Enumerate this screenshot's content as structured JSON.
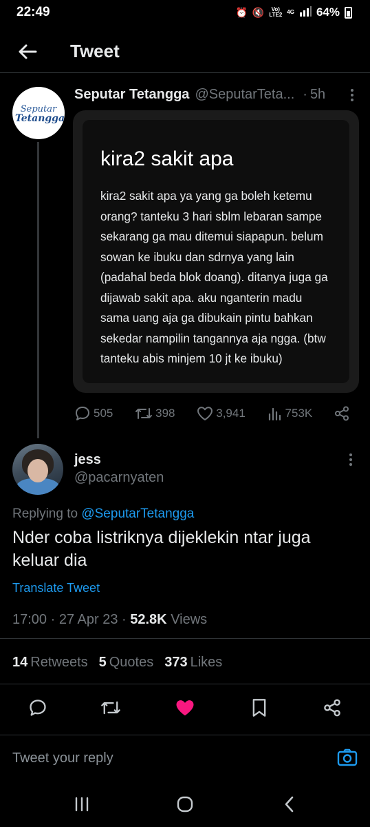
{
  "status_bar": {
    "time": "22:49",
    "net_top": "Vo)",
    "net_bottom": "LTE2",
    "net_type": "4G",
    "battery": "64%"
  },
  "header": {
    "title": "Tweet"
  },
  "quoted_tweet": {
    "name": "Seputar Tetangga",
    "handle": "@SeputarTeta...",
    "time": "5h",
    "avatar_logo_line1": "Seputar",
    "avatar_logo_line2": "Tetangga",
    "card_title": "kira2 sakit apa",
    "card_body": "kira2 sakit apa ya yang ga boleh ketemu orang? tanteku 3 hari sblm lebaran sampe sekarang ga mau ditemui siapapun. belum sowan ke ibuku dan sdrnya yang lain (padahal beda blok doang). ditanya juga ga dijawab sakit apa. aku nganterin madu sama uang aja ga dibukain pintu bahkan sekedar nampilin tangannya aja ngga. (btw tanteku abis minjem 10 jt ke ibuku)",
    "replies": "505",
    "retweets": "398",
    "likes": "3,941",
    "views": "753K"
  },
  "reply_tweet": {
    "name": "jess",
    "handle": "@pacarnyaten",
    "replying_prefix": "Replying to",
    "replying_to": "@SeputarTetangga",
    "text": "Nder coba listriknya dijeklekin ntar juga keluar dia",
    "translate": "Translate Tweet",
    "time": "17:00",
    "date": "27 Apr 23",
    "views_count": "52.8K",
    "views_label": "Views",
    "retweets_count": "14",
    "retweets_label": "Retweets",
    "quotes_count": "5",
    "quotes_label": "Quotes",
    "likes_count": "373",
    "likes_label": "Likes"
  },
  "reply_box": {
    "placeholder": "Tweet your reply"
  },
  "colors": {
    "accent": "#1d9bf0",
    "like": "#f91880",
    "background": "#000000"
  },
  "icons": [
    "back-arrow-icon",
    "more-icon",
    "reply-icon",
    "retweet-icon",
    "like-icon",
    "views-icon",
    "share-icon",
    "bookmark-icon",
    "camera-icon",
    "recents-icon",
    "home-icon",
    "back-icon"
  ]
}
